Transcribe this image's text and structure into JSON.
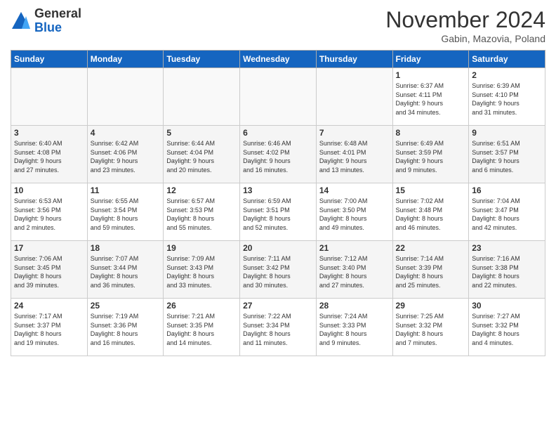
{
  "header": {
    "logo_general": "General",
    "logo_blue": "Blue",
    "month_title": "November 2024",
    "subtitle": "Gabin, Mazovia, Poland"
  },
  "weekdays": [
    "Sunday",
    "Monday",
    "Tuesday",
    "Wednesday",
    "Thursday",
    "Friday",
    "Saturday"
  ],
  "weeks": [
    [
      {
        "day": "",
        "info": ""
      },
      {
        "day": "",
        "info": ""
      },
      {
        "day": "",
        "info": ""
      },
      {
        "day": "",
        "info": ""
      },
      {
        "day": "",
        "info": ""
      },
      {
        "day": "1",
        "info": "Sunrise: 6:37 AM\nSunset: 4:11 PM\nDaylight: 9 hours\nand 34 minutes."
      },
      {
        "day": "2",
        "info": "Sunrise: 6:39 AM\nSunset: 4:10 PM\nDaylight: 9 hours\nand 31 minutes."
      }
    ],
    [
      {
        "day": "3",
        "info": "Sunrise: 6:40 AM\nSunset: 4:08 PM\nDaylight: 9 hours\nand 27 minutes."
      },
      {
        "day": "4",
        "info": "Sunrise: 6:42 AM\nSunset: 4:06 PM\nDaylight: 9 hours\nand 23 minutes."
      },
      {
        "day": "5",
        "info": "Sunrise: 6:44 AM\nSunset: 4:04 PM\nDaylight: 9 hours\nand 20 minutes."
      },
      {
        "day": "6",
        "info": "Sunrise: 6:46 AM\nSunset: 4:02 PM\nDaylight: 9 hours\nand 16 minutes."
      },
      {
        "day": "7",
        "info": "Sunrise: 6:48 AM\nSunset: 4:01 PM\nDaylight: 9 hours\nand 13 minutes."
      },
      {
        "day": "8",
        "info": "Sunrise: 6:49 AM\nSunset: 3:59 PM\nDaylight: 9 hours\nand 9 minutes."
      },
      {
        "day": "9",
        "info": "Sunrise: 6:51 AM\nSunset: 3:57 PM\nDaylight: 9 hours\nand 6 minutes."
      }
    ],
    [
      {
        "day": "10",
        "info": "Sunrise: 6:53 AM\nSunset: 3:56 PM\nDaylight: 9 hours\nand 2 minutes."
      },
      {
        "day": "11",
        "info": "Sunrise: 6:55 AM\nSunset: 3:54 PM\nDaylight: 8 hours\nand 59 minutes."
      },
      {
        "day": "12",
        "info": "Sunrise: 6:57 AM\nSunset: 3:53 PM\nDaylight: 8 hours\nand 55 minutes."
      },
      {
        "day": "13",
        "info": "Sunrise: 6:59 AM\nSunset: 3:51 PM\nDaylight: 8 hours\nand 52 minutes."
      },
      {
        "day": "14",
        "info": "Sunrise: 7:00 AM\nSunset: 3:50 PM\nDaylight: 8 hours\nand 49 minutes."
      },
      {
        "day": "15",
        "info": "Sunrise: 7:02 AM\nSunset: 3:48 PM\nDaylight: 8 hours\nand 46 minutes."
      },
      {
        "day": "16",
        "info": "Sunrise: 7:04 AM\nSunset: 3:47 PM\nDaylight: 8 hours\nand 42 minutes."
      }
    ],
    [
      {
        "day": "17",
        "info": "Sunrise: 7:06 AM\nSunset: 3:45 PM\nDaylight: 8 hours\nand 39 minutes."
      },
      {
        "day": "18",
        "info": "Sunrise: 7:07 AM\nSunset: 3:44 PM\nDaylight: 8 hours\nand 36 minutes."
      },
      {
        "day": "19",
        "info": "Sunrise: 7:09 AM\nSunset: 3:43 PM\nDaylight: 8 hours\nand 33 minutes."
      },
      {
        "day": "20",
        "info": "Sunrise: 7:11 AM\nSunset: 3:42 PM\nDaylight: 8 hours\nand 30 minutes."
      },
      {
        "day": "21",
        "info": "Sunrise: 7:12 AM\nSunset: 3:40 PM\nDaylight: 8 hours\nand 27 minutes."
      },
      {
        "day": "22",
        "info": "Sunrise: 7:14 AM\nSunset: 3:39 PM\nDaylight: 8 hours\nand 25 minutes."
      },
      {
        "day": "23",
        "info": "Sunrise: 7:16 AM\nSunset: 3:38 PM\nDaylight: 8 hours\nand 22 minutes."
      }
    ],
    [
      {
        "day": "24",
        "info": "Sunrise: 7:17 AM\nSunset: 3:37 PM\nDaylight: 8 hours\nand 19 minutes."
      },
      {
        "day": "25",
        "info": "Sunrise: 7:19 AM\nSunset: 3:36 PM\nDaylight: 8 hours\nand 16 minutes."
      },
      {
        "day": "26",
        "info": "Sunrise: 7:21 AM\nSunset: 3:35 PM\nDaylight: 8 hours\nand 14 minutes."
      },
      {
        "day": "27",
        "info": "Sunrise: 7:22 AM\nSunset: 3:34 PM\nDaylight: 8 hours\nand 11 minutes."
      },
      {
        "day": "28",
        "info": "Sunrise: 7:24 AM\nSunset: 3:33 PM\nDaylight: 8 hours\nand 9 minutes."
      },
      {
        "day": "29",
        "info": "Sunrise: 7:25 AM\nSunset: 3:32 PM\nDaylight: 8 hours\nand 7 minutes."
      },
      {
        "day": "30",
        "info": "Sunrise: 7:27 AM\nSunset: 3:32 PM\nDaylight: 8 hours\nand 4 minutes."
      }
    ]
  ]
}
